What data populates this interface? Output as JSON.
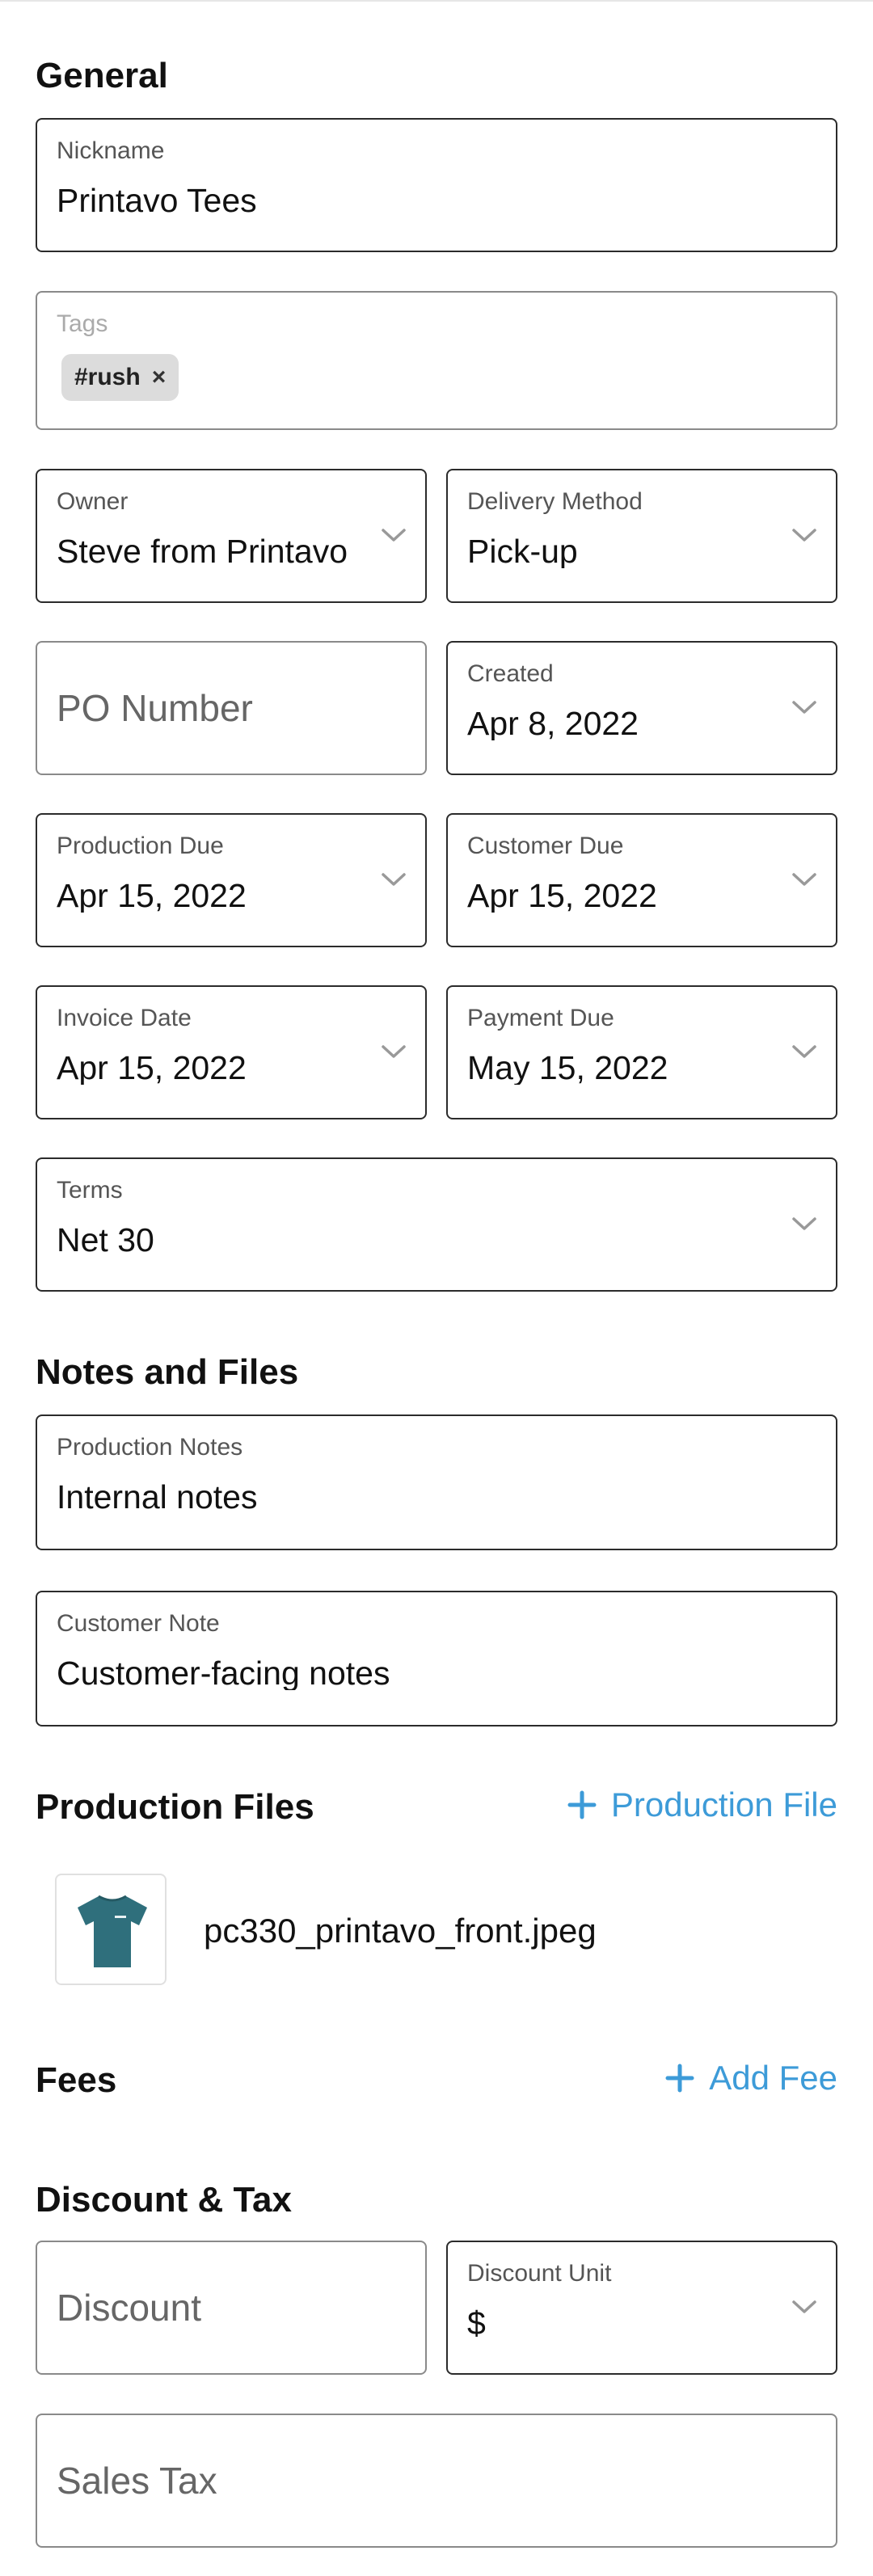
{
  "sections": {
    "general": "General",
    "notes_files": "Notes and Files",
    "production_files": "Production Files",
    "fees": "Fees",
    "discount_tax": "Discount & Tax"
  },
  "fields": {
    "nickname": {
      "label": "Nickname",
      "value": "Printavo Tees"
    },
    "tags": {
      "label": "Tags",
      "items": [
        "#rush"
      ],
      "remove_symbol": "×"
    },
    "owner": {
      "label": "Owner",
      "value": "Steve from Printavo"
    },
    "delivery_method": {
      "label": "Delivery Method",
      "value": "Pick-up"
    },
    "po_number": {
      "placeholder": "PO Number"
    },
    "created": {
      "label": "Created",
      "value": "Apr 8, 2022"
    },
    "production_due": {
      "label": "Production Due",
      "value": "Apr 15, 2022"
    },
    "customer_due": {
      "label": "Customer Due",
      "value": "Apr 15, 2022"
    },
    "invoice_date": {
      "label": "Invoice Date",
      "value": "Apr 15, 2022"
    },
    "payment_due": {
      "label": "Payment Due",
      "value": "May 15, 2022"
    },
    "terms": {
      "label": "Terms",
      "value": "Net 30"
    },
    "production_notes": {
      "label": "Production Notes",
      "value": "Internal notes"
    },
    "customer_note": {
      "label": "Customer Note",
      "value": "Customer-facing notes"
    },
    "discount": {
      "placeholder": "Discount"
    },
    "discount_unit": {
      "label": "Discount Unit",
      "value": "$"
    },
    "sales_tax": {
      "placeholder": "Sales Tax"
    }
  },
  "actions": {
    "add_production_file": "Production File",
    "add_fee": "Add Fee"
  },
  "files": [
    {
      "name": "pc330_printavo_front.jpeg",
      "thumbnail_icon": "tshirt-icon"
    }
  ],
  "colors": {
    "accent": "#3d9bd8",
    "border": "#2b2b2b",
    "tag_bg": "#dcdcdc",
    "shirt": "#2f6f7c"
  }
}
